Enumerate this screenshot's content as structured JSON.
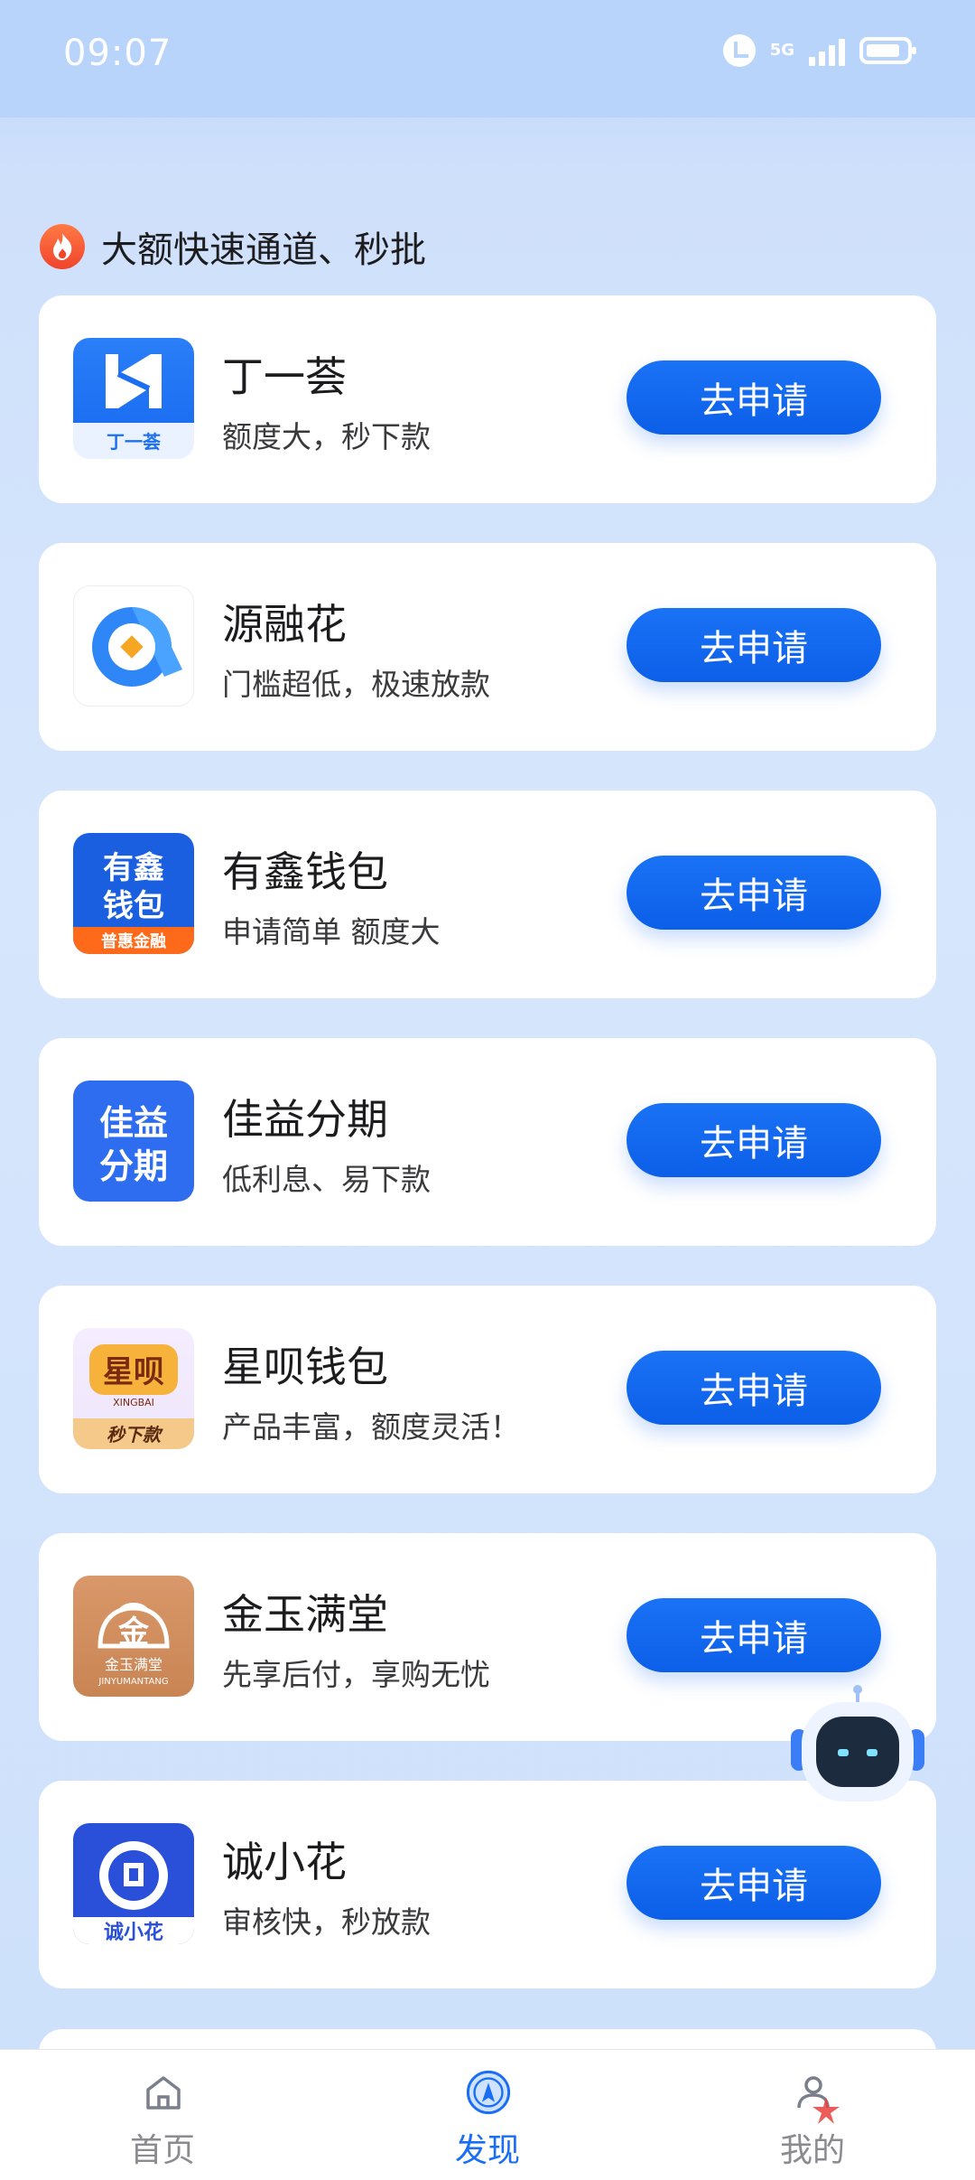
{
  "status_bar": {
    "time": "09:07",
    "network": "5G"
  },
  "section": {
    "title": "大额快速通道、秒批",
    "icon": "fire-icon"
  },
  "apps": [
    {
      "name": "丁一荟",
      "desc": "额度大，秒下款",
      "button": "去申请",
      "logo_text": "丁一荟"
    },
    {
      "name": "源融花",
      "desc": "门槛超低，极速放款",
      "button": "去申请",
      "logo_text": ""
    },
    {
      "name": "有鑫钱包",
      "desc": "申请简单 额度大",
      "button": "去申请",
      "logo_text": "有鑫钱包",
      "logo_sub": "普惠金融"
    },
    {
      "name": "佳益分期",
      "desc": "低利息、易下款",
      "button": "去申请",
      "logo_text": "佳益分期"
    },
    {
      "name": "星呗钱包",
      "desc": "产品丰富，额度灵活！",
      "button": "去申请",
      "logo_text": "星呗",
      "logo_sub": "秒下款"
    },
    {
      "name": "金玉满堂",
      "desc": "先享后付，享购无忧",
      "button": "去申请",
      "logo_text": "金玉满堂",
      "logo_sub": "JINYUMANTANG"
    },
    {
      "name": "诚小花",
      "desc": "审核快，秒放款",
      "button": "去申请",
      "logo_text": "诚小花"
    }
  ],
  "nav": [
    {
      "label": "首页",
      "icon": "home-icon",
      "active": false
    },
    {
      "label": "发现",
      "icon": "compass-icon",
      "active": true
    },
    {
      "label": "我的",
      "icon": "user-icon",
      "active": false
    }
  ],
  "colors": {
    "accent": "#1a6ef5",
    "button": "#0c5fe8",
    "background": "#d6e6fc"
  }
}
